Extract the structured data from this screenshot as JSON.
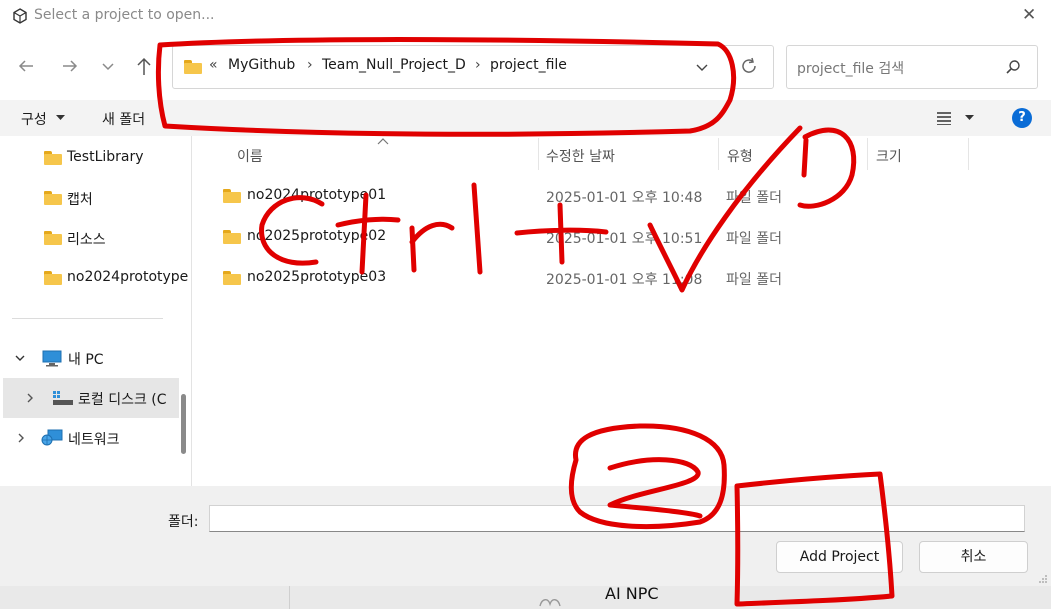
{
  "window": {
    "title": "Select a project to open...",
    "close_glyph": "✕"
  },
  "address_bar": {
    "overflow": "«",
    "crumbs": [
      "MyGithub",
      "Team_Null_Project_D",
      "project_file"
    ],
    "separator": "›"
  },
  "search": {
    "placeholder": "project_file 검색"
  },
  "toolbar": {
    "organize": "구성",
    "new_folder": "새 폴더",
    "help": "?"
  },
  "sidebar": {
    "quick_items": [
      "TestLibrary",
      "캡처",
      "리소스",
      "no2024prototype"
    ],
    "this_pc": "내 PC",
    "local_disk": "로컬 디스크 (C",
    "network": "네트워크"
  },
  "columns": {
    "name": "이름",
    "date": "수정한 날짜",
    "type": "유형",
    "size": "크기"
  },
  "files": [
    {
      "name": "no2024prototype01",
      "date": "2025-01-01 오후 10:48",
      "type": "파일 폴더"
    },
    {
      "name": "no2025prototype02",
      "date": "2025-01-01 오후 10:51",
      "type": "파일 폴더"
    },
    {
      "name": "no2025prototype03",
      "date": "2025-01-01 오후 11:08",
      "type": "파일 폴더"
    }
  ],
  "bottom": {
    "folder_label": "폴더:",
    "folder_value": "",
    "add_button": "Add Project",
    "cancel_button": "취소"
  },
  "background_app": {
    "label": "AI NPC"
  },
  "colors": {
    "annotation": "#e00000",
    "help_blue": "#0a6cd6",
    "folder_yellow": "#f6c64b"
  }
}
